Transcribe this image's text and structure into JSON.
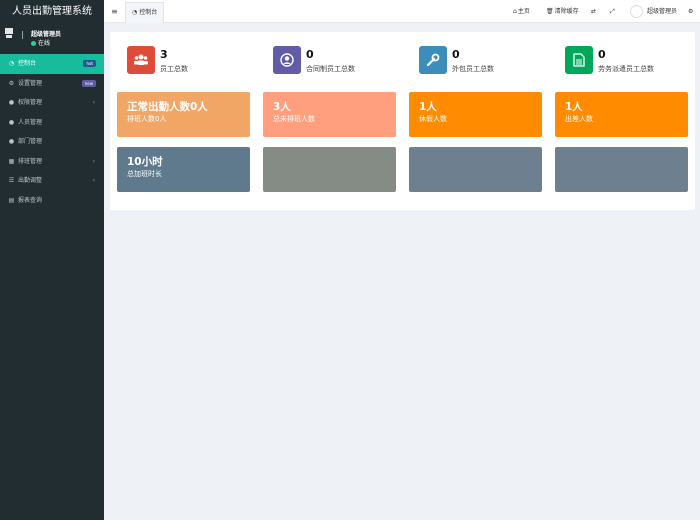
{
  "app": {
    "title": "人员出勤管理系统"
  },
  "user": {
    "name": "超级管理员",
    "status": "在线"
  },
  "menu": [
    {
      "label": "控制台",
      "icon": "dashboard-icon",
      "badge": "hot",
      "active": true
    },
    {
      "label": "设置管理",
      "icon": "cogs-icon",
      "badge": "new"
    },
    {
      "label": "权限管理",
      "icon": "group-icon",
      "chevron": true
    },
    {
      "label": "人员管理",
      "icon": "user-icon"
    },
    {
      "label": "部门管理",
      "icon": "users-icon"
    },
    {
      "label": "排班管理",
      "icon": "calendar-icon",
      "chevron": true
    },
    {
      "label": "出勤调整",
      "icon": "list-icon",
      "chevron": true
    },
    {
      "label": "报表查询",
      "icon": "report-icon"
    }
  ],
  "header": {
    "tab_label": "控制台",
    "nav": {
      "home": "主页",
      "clear_cache": "清除缓存",
      "admin": "超级管理员"
    }
  },
  "stats": [
    {
      "value": "3",
      "label": "员工总数",
      "color": "#dd4b39",
      "icon": "users-icon"
    },
    {
      "value": "0",
      "label": "合同制员工总数",
      "color": "#605ca8",
      "icon": "user-circle-icon"
    },
    {
      "value": "0",
      "label": "外包员工总数",
      "color": "#3c8dbc",
      "icon": "wrench-icon"
    },
    {
      "value": "0",
      "label": "劳务派遣员工总数",
      "color": "#00a65a",
      "icon": "document-icon"
    }
  ],
  "boxes": [
    {
      "title": "正常出勤人数0人",
      "sub": "排班人数0人",
      "color": "#f2a666"
    },
    {
      "title": "3人",
      "sub": "总未排班人数",
      "color": "#ff9f7e"
    },
    {
      "title": "1人",
      "sub": "休假人数",
      "color": "#ff8c00"
    },
    {
      "title": "1人",
      "sub": "出差人数",
      "color": "#ff8c00"
    },
    {
      "title": "10小时",
      "sub": "总加班时长",
      "color": "#5f7a8c"
    },
    {
      "title": "",
      "sub": "",
      "color": "#858b85"
    },
    {
      "title": "",
      "sub": "",
      "color": "#6e7f8f"
    },
    {
      "title": "",
      "sub": "",
      "color": "#6e7f8f"
    }
  ]
}
